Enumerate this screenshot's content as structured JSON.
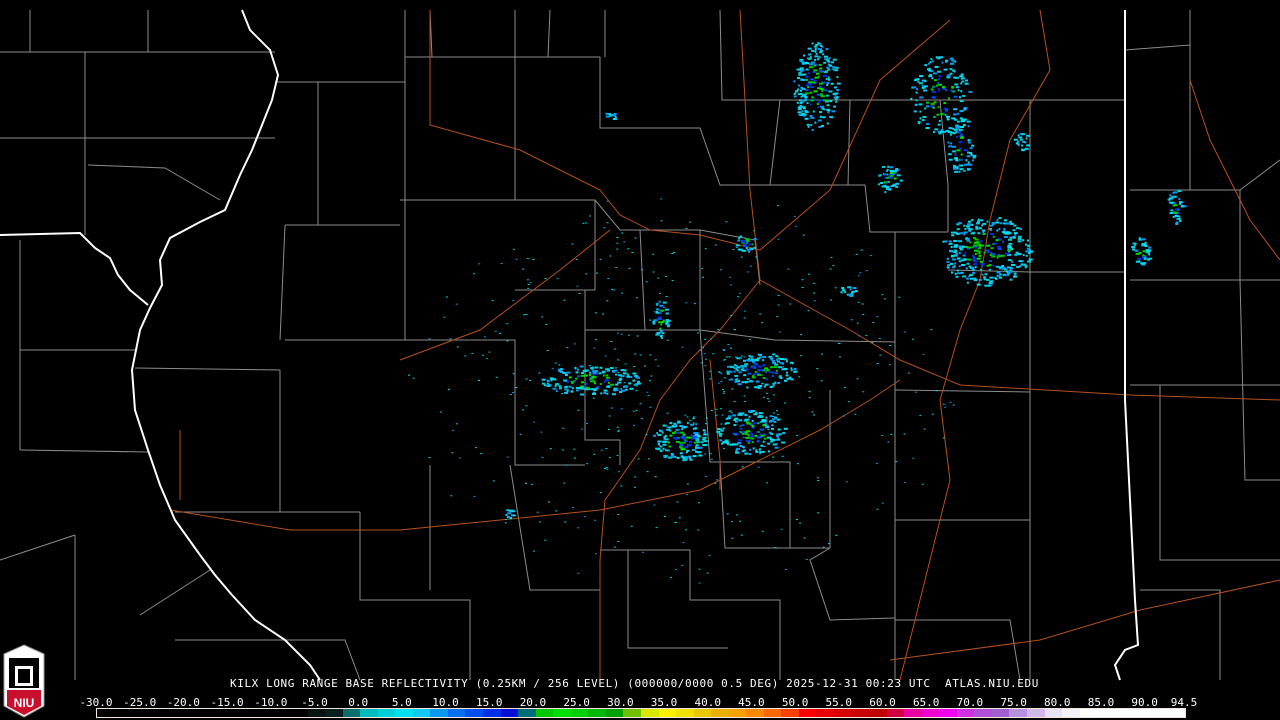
{
  "product": {
    "caption": "KILX LONG RANGE BASE REFLECTIVITY (0.25KM / 256 LEVEL) (000000/0000 0.5 DEG) 2025-12-31 00:23 UTC  ATLAS.NIU.EDU",
    "station": "KILX",
    "date": "2025-12-31",
    "time": "00:23 UTC",
    "site": "ATLAS.NIU.EDU"
  },
  "logo": {
    "text": "NIU"
  },
  "legend": {
    "ticks": [
      "-30.0",
      "-25.0",
      "-20.0",
      "-15.0",
      "-10.0",
      "-5.0",
      "0.0",
      "5.0",
      "10.0",
      "15.0",
      "20.0",
      "25.0",
      "30.0",
      "35.0",
      "40.0",
      "45.0",
      "50.0",
      "55.0",
      "60.0",
      "65.0",
      "70.0",
      "75.0",
      "80.0",
      "85.0",
      "90.0",
      "94.5"
    ],
    "min": -30.0,
    "max": 94.5,
    "colors": [
      "#000000",
      "#000000",
      "#000000",
      "#000000",
      "#000000",
      "#000000",
      "#000000",
      "#000000",
      "#000000",
      "#000000",
      "#000000",
      "#000000",
      "#081414",
      "#0a1e1e",
      "#0a6e6e",
      "#00bcbc",
      "#00d0d8",
      "#00e0f0",
      "#10c8f0",
      "#0898f0",
      "#0870f0",
      "#0050f0",
      "#0030e8",
      "#0010d8",
      "#006e78",
      "#00c800",
      "#00e000",
      "#00d000",
      "#00b800",
      "#00a000",
      "#70c000",
      "#d8e800",
      "#f8f000",
      "#f0e000",
      "#e8c800",
      "#e8b000",
      "#f8a000",
      "#f88800",
      "#f86800",
      "#f84000",
      "#f80000",
      "#e80000",
      "#d80000",
      "#c80000",
      "#c00000",
      "#d00040",
      "#e800a0",
      "#f000d0",
      "#f000f0",
      "#d030e0",
      "#b050d8",
      "#a060d0",
      "#b890e0",
      "#d0b8e8",
      "#e8e0f4",
      "#f4f0f8",
      "#ffffff",
      "#ffffff",
      "#ffffff",
      "#ffffff",
      "#ffffff",
      "#ffffff"
    ]
  },
  "colors": {
    "county": "#8c8c8c",
    "state": "#ffffff",
    "highway": "#b4501e"
  }
}
